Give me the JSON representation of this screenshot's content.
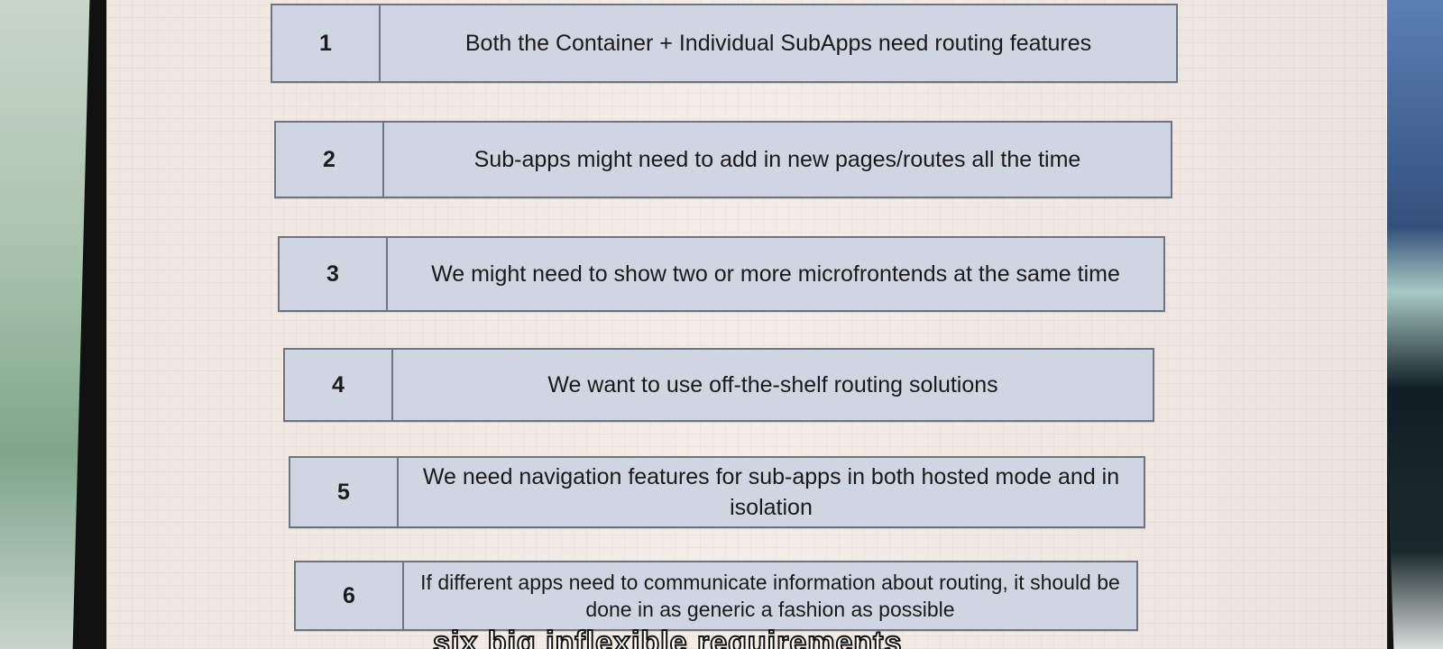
{
  "requirements": [
    {
      "number": "1",
      "text": "Both the Container + Individual SubApps need routing features"
    },
    {
      "number": "2",
      "text": "Sub-apps might need to add in new pages/routes all the time"
    },
    {
      "number": "3",
      "text": "We might need to show two or more microfrontends at the same time"
    },
    {
      "number": "4",
      "text": "We want to use off-the-shelf routing solutions"
    },
    {
      "number": "5",
      "text": "We need navigation features for sub-apps in both hosted mode and in isolation"
    },
    {
      "number": "6",
      "text": "If different apps need to communicate information about routing, it should be done in as generic a fashion as possible"
    }
  ],
  "caption": "six big inflexible requirements"
}
